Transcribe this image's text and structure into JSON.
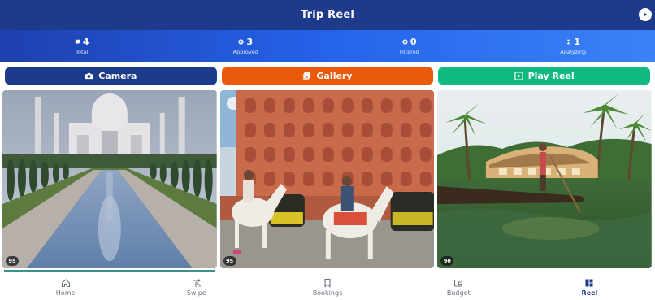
{
  "header": {
    "title": "Trip Reel"
  },
  "stats": [
    {
      "value": "4",
      "label": "Total",
      "icon": "photos-icon"
    },
    {
      "value": "3",
      "label": "Approved",
      "icon": "check-circle-icon"
    },
    {
      "value": "0",
      "label": "Filtered",
      "icon": "x-circle-icon"
    },
    {
      "value": "1",
      "label": "Analyzing",
      "icon": "hourglass-icon"
    }
  ],
  "actions": {
    "camera": "Camera",
    "gallery": "Gallery",
    "play_reel": "Play Reel"
  },
  "photos": [
    {
      "score": "95",
      "subject": "taj-mahal"
    },
    {
      "score": "95",
      "subject": "hawa-mahal-camels"
    },
    {
      "score": "90",
      "subject": "kerala-backwaters"
    }
  ],
  "nav": [
    {
      "label": "Home",
      "icon": "home-icon",
      "active": false
    },
    {
      "label": "Swipe",
      "icon": "swipe-icon",
      "active": false
    },
    {
      "label": "Bookings",
      "icon": "bookmark-icon",
      "active": false
    },
    {
      "label": "Budget",
      "icon": "wallet-icon",
      "active": false
    },
    {
      "label": "Reel",
      "icon": "reel-icon",
      "active": true
    }
  ],
  "colors": {
    "header": "#1e3a8a",
    "camera": "#1e3a8a",
    "gallery": "#ea580c",
    "play_reel": "#10b981"
  }
}
